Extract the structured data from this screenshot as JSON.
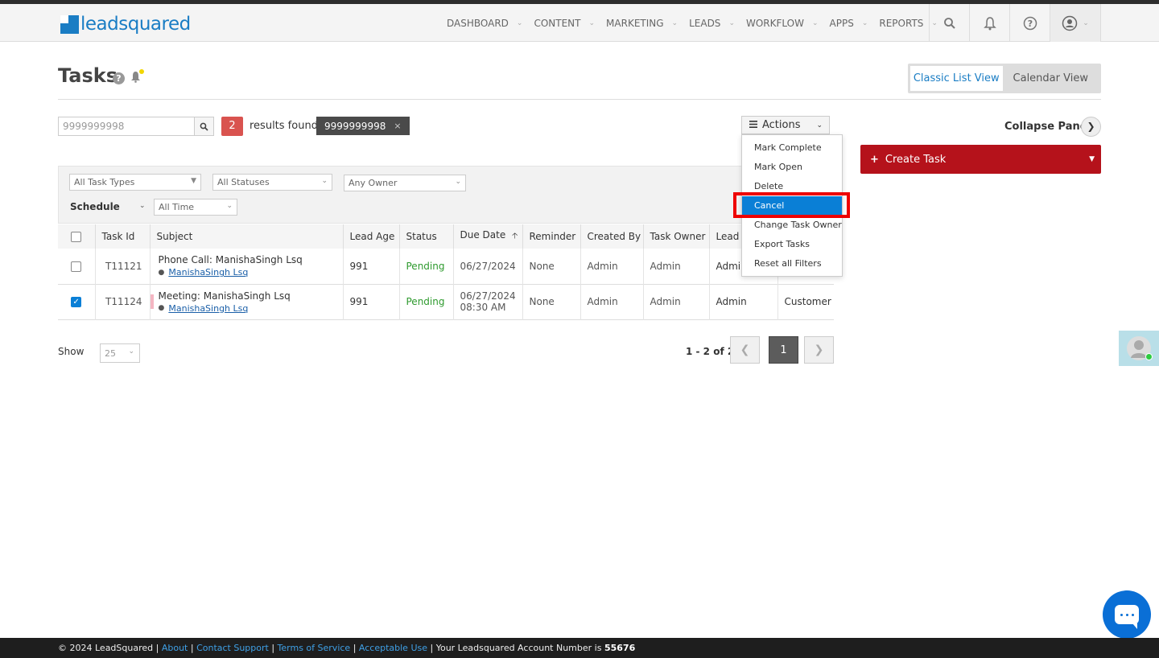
{
  "brand": {
    "name": "leadsquared"
  },
  "nav": {
    "items": [
      {
        "label": "DASHBOARD"
      },
      {
        "label": "CONTENT"
      },
      {
        "label": "MARKETING"
      },
      {
        "label": "LEADS"
      },
      {
        "label": "WORKFLOW"
      },
      {
        "label": "APPS"
      },
      {
        "label": "REPORTS"
      }
    ],
    "icons": [
      "search-icon",
      "bell-icon",
      "help-icon",
      "user-icon"
    ]
  },
  "page": {
    "title": "Tasks"
  },
  "views": {
    "classic": "Classic List View",
    "calendar": "Calendar View"
  },
  "search": {
    "value": "9999999998",
    "count": "2",
    "results_text": "results found",
    "chip": "9999999998",
    "chip_close": "×"
  },
  "actions": {
    "label": "Actions",
    "items": [
      "Mark Complete",
      "Mark Open",
      "Delete",
      "Cancel",
      "Change Task Owner",
      "Export Tasks",
      "Reset all Filters"
    ],
    "highlighted": "Cancel"
  },
  "panel": {
    "collapse_label": "Collapse Panel",
    "create_task": "Create Task"
  },
  "filters": {
    "task_types": "All Task Types",
    "statuses": "All Statuses",
    "owner": "Any Owner",
    "schedule": "Schedule",
    "time": "All Time"
  },
  "table": {
    "headers": [
      "Task Id",
      "Subject",
      "Lead Age",
      "Status",
      "Due Date",
      "Reminder",
      "Created By",
      "Task Owner",
      "Lead C"
    ],
    "rows": [
      {
        "checked": false,
        "id": "T11121",
        "subject": "Phone Call: ManishaSingh Lsq",
        "lead": "ManishaSingh Lsq",
        "lead_age": "991",
        "status": "Pending",
        "due": "06/27/2024",
        "due_time": "",
        "reminder": "None",
        "created_by": "Admin",
        "owner": "Admin",
        "lead_owner": "Admi",
        "extra": ""
      },
      {
        "checked": true,
        "id": "T11124",
        "subject": "Meeting: ManishaSingh Lsq",
        "lead": "ManishaSingh Lsq",
        "lead_age": "991",
        "status": "Pending",
        "due": "06/27/2024",
        "due_time": "08:30 AM",
        "reminder": "None",
        "created_by": "Admin",
        "owner": "Admin",
        "lead_owner": "Admin",
        "extra": "Customer"
      }
    ]
  },
  "pagination": {
    "show_label": "Show",
    "page_size": "25",
    "info": "1 - 2 of 2",
    "current": "1"
  },
  "footer": {
    "copyright": "© 2024 LeadSquared |",
    "links": [
      "About",
      "Contact Support",
      "Terms of Service",
      "Acceptable Use"
    ],
    "account_text": "Your Leadsquared Account Number is",
    "account_number": "55676"
  },
  "colors": {
    "brand_blue": "#1a7dc4",
    "create_red": "#b5121b",
    "highlight_blue": "#0a7fd6",
    "pending_green": "#2e9a2e",
    "badge_red": "#d9534f"
  }
}
